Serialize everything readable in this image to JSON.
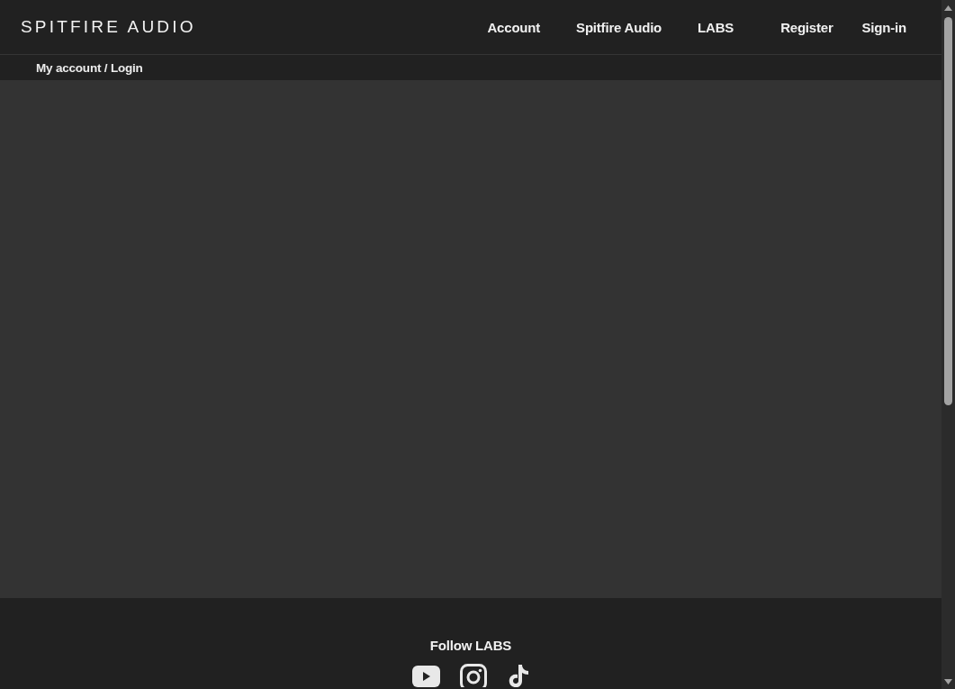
{
  "header": {
    "logo": "SPITFIRE AUDIO",
    "nav_links": [
      "Account",
      "Spitfire Audio",
      "LABS"
    ],
    "auth_links": [
      "Register",
      "Sign-in"
    ]
  },
  "breadcrumb": "My account / Login",
  "footer": {
    "heading": "Follow LABS",
    "social_links": [
      {
        "kind": "youtube"
      },
      {
        "kind": "instagram"
      },
      {
        "kind": "tiktok"
      }
    ]
  }
}
